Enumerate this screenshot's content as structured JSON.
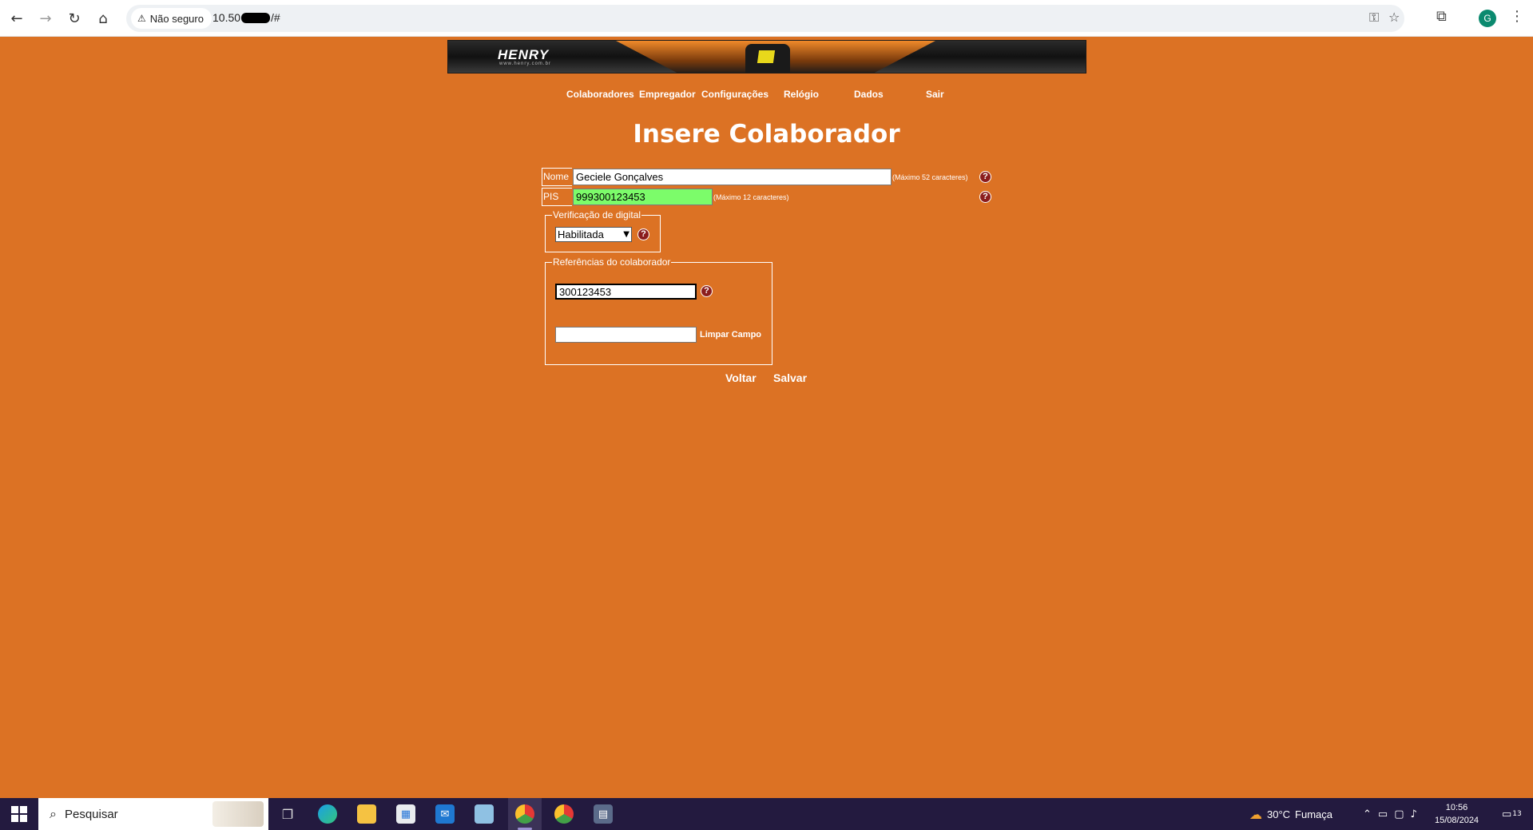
{
  "browser": {
    "security_label": "Não seguro",
    "url_prefix": "10.50",
    "url_suffix": "/#",
    "avatar_letter": "G"
  },
  "banner": {
    "logo_text": "HENRY",
    "logo_url": "www.henry.com.br"
  },
  "menu": {
    "items": [
      "Colaboradores",
      "Empregador",
      "Configurações",
      "Relógio",
      "Dados",
      "Sair"
    ]
  },
  "page": {
    "title": "Insere Colaborador"
  },
  "form": {
    "nome_label": "Nome",
    "nome_value": "Geciele Gonçalves",
    "nome_hint": "(Máximo 52 caracteres)",
    "pis_label": "PIS",
    "pis_value": "999300123453",
    "pis_hint": "(Máximo 12 caracteres)",
    "help_glyph": "?",
    "verificacao_legend": "Verificação de digital",
    "verificacao_selected": "Habilitada",
    "referencias_legend": "Referências do colaborador",
    "referencia1_value": "300123453",
    "referencia2_value": "",
    "limpar_label": "Limpar Campo",
    "voltar_label": "Voltar",
    "salvar_label": "Salvar"
  },
  "taskbar": {
    "search_placeholder": "Pesquisar",
    "weather_temp": "30°C",
    "weather_desc": "Fumaça",
    "time": "10:56",
    "date": "15/08/2024",
    "notification_count": "13"
  },
  "colors": {
    "page_background": "#dc7224",
    "pis_field_background": "#7cfc6a",
    "help_icon": "#8b1d1d",
    "taskbar": "#231a3f"
  }
}
